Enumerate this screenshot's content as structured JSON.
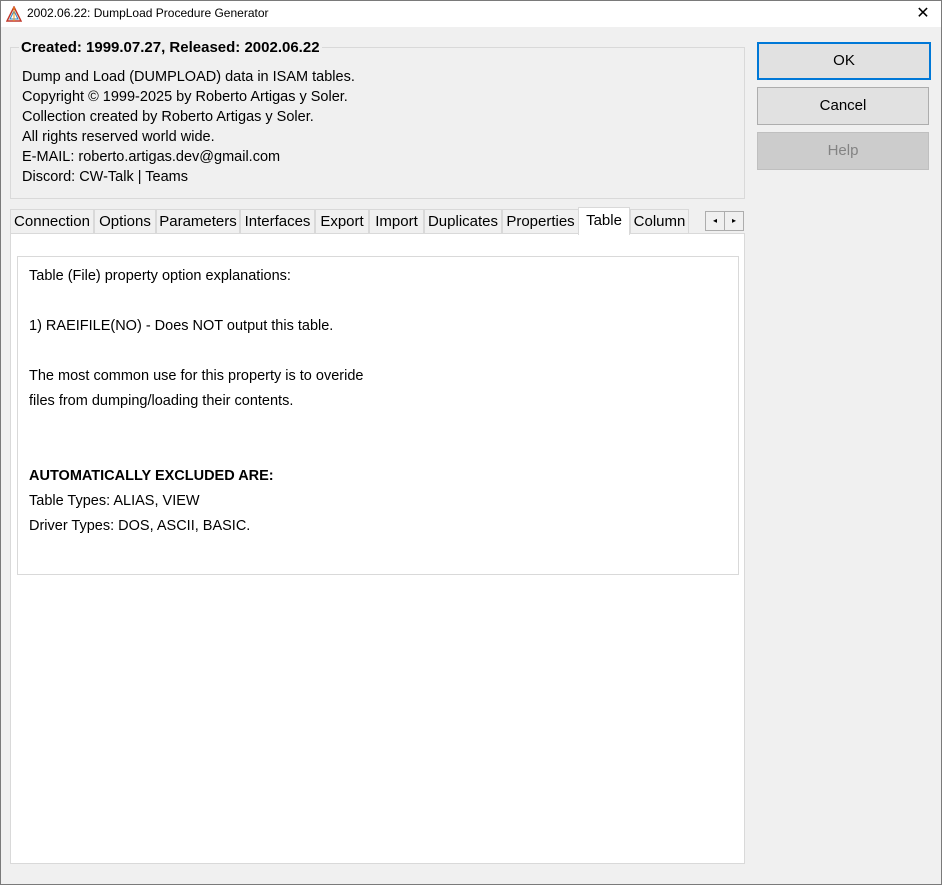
{
  "window": {
    "title": "2002.06.22: DumpLoad Procedure Generator",
    "close_glyph": "✕",
    "app_icon": "triangle-app-icon"
  },
  "info": {
    "group_title": "Created: 1999.07.27, Released: 2002.06.22",
    "lines": [
      "Dump and Load (DUMPLOAD) data in ISAM tables.",
      "Copyright © 1999-2025 by Roberto Artigas y Soler.",
      "Collection created by Roberto Artigas y Soler.",
      "All rights reserved world wide.",
      "E-MAIL: roberto.artigas.dev@gmail.com",
      "Discord: CW-Talk | Teams"
    ]
  },
  "buttons": {
    "ok": "OK",
    "cancel": "Cancel",
    "help": "Help"
  },
  "tabs": [
    {
      "label": "Connection"
    },
    {
      "label": "Options"
    },
    {
      "label": "Parameters"
    },
    {
      "label": "Interfaces"
    },
    {
      "label": "Export"
    },
    {
      "label": "Import"
    },
    {
      "label": "Duplicates"
    },
    {
      "label": "Properties"
    },
    {
      "label": "Table",
      "active": true
    },
    {
      "label": "Column"
    }
  ],
  "tab_scroll": {
    "left": "◂",
    "right": "▸"
  },
  "table_tab": {
    "lines": [
      "Table (File) property option explanations:",
      "1) RAEIFILE(NO) - Does NOT output this table.",
      "The most common use for this property is to overide",
      "files from dumping/loading their contents.",
      "AUTOMATICALLY EXCLUDED ARE:",
      "Table Types: ALIAS, VIEW",
      "Driver Types: DOS, ASCII, BASIC."
    ]
  },
  "colors": {
    "accent": "#0078d7",
    "background": "#f0f0f0"
  }
}
